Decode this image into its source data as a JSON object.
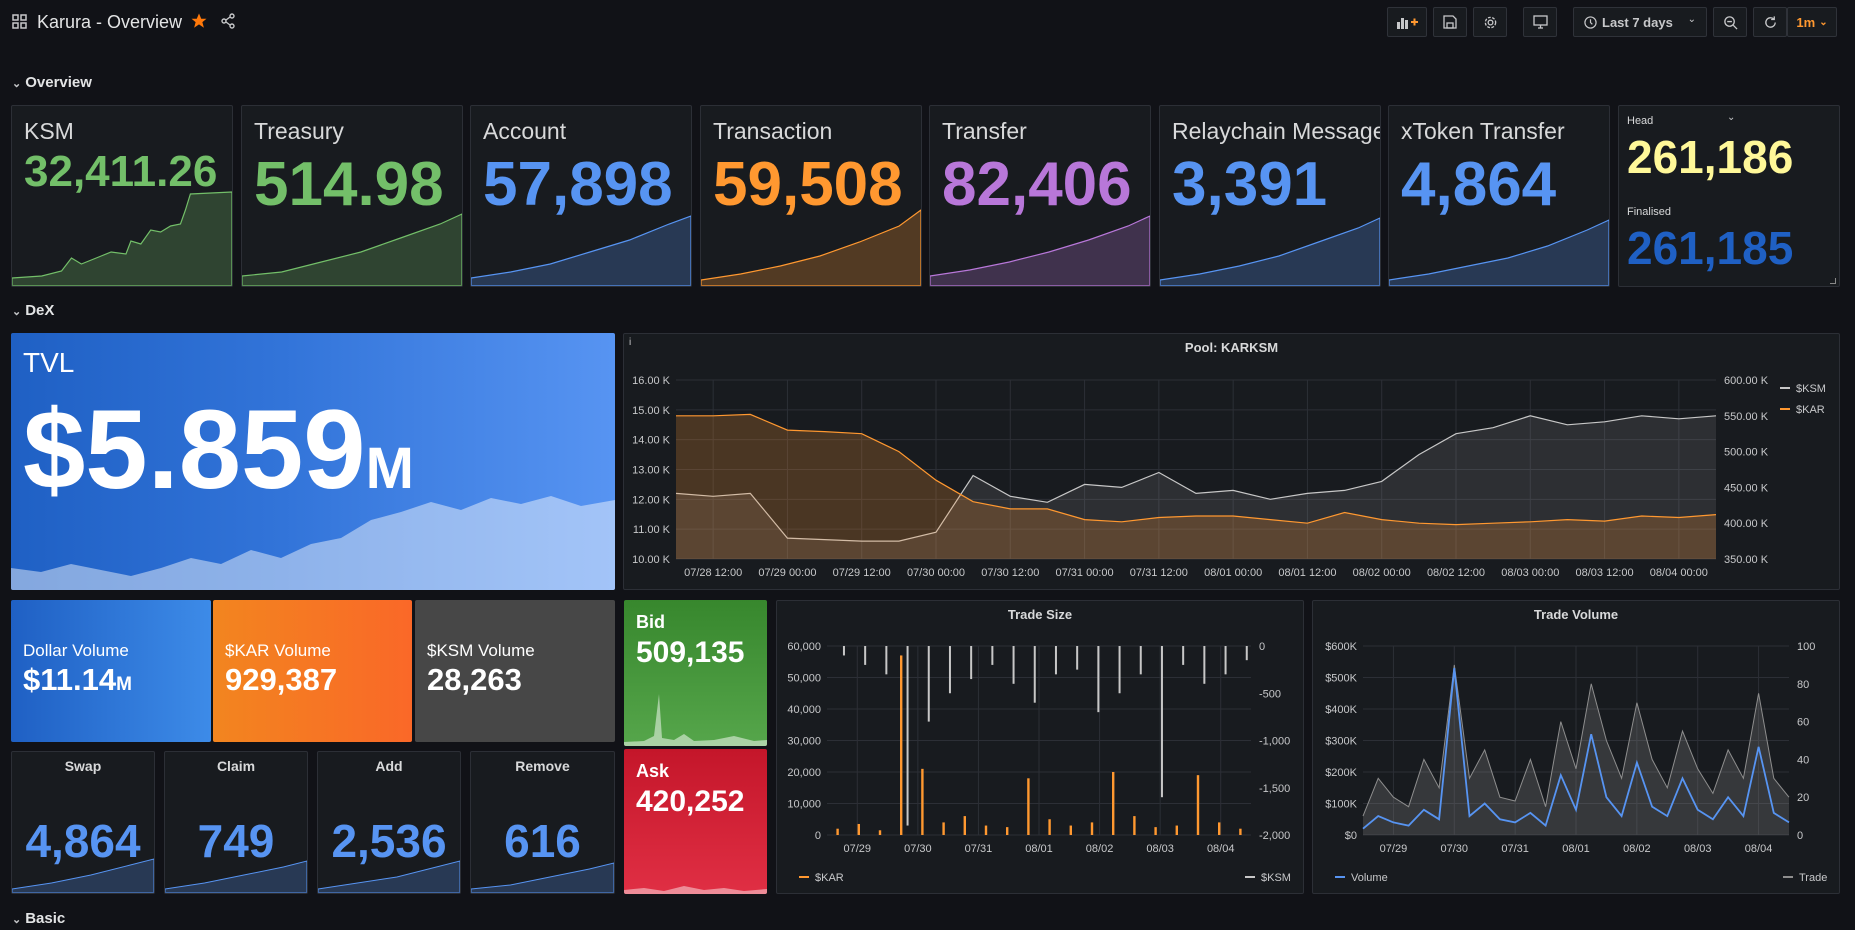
{
  "header": {
    "title": "Karura - Overview",
    "time_range": "Last 7 days",
    "refresh_interval": "1m"
  },
  "rows": {
    "overview": "Overview",
    "dex": "DeX",
    "basic": "Basic"
  },
  "stats": [
    {
      "title": "KSM",
      "value": "32,411.26",
      "color": "#73bf69"
    },
    {
      "title": "Treasury",
      "value": "514.98",
      "color": "#73bf69"
    },
    {
      "title": "Account",
      "value": "57,898",
      "color": "#5794f2"
    },
    {
      "title": "Transaction",
      "value": "59,508",
      "color": "#ff9830"
    },
    {
      "title": "Transfer",
      "value": "82,406",
      "color": "#b877d9"
    },
    {
      "title": "Relaychain Message",
      "value": "3,391",
      "color": "#5794f2"
    },
    {
      "title": "xToken Transfer",
      "value": "4,864",
      "color": "#5794f2"
    }
  ],
  "head": {
    "head_label": "Head",
    "head_value": "261,186",
    "finalised_label": "Finalised",
    "finalised_value": "261,185",
    "head_color": "#fff899",
    "finalised_color": "#1f60c4"
  },
  "tvl": {
    "title": "TVL",
    "value": "$5.859",
    "unit": "M"
  },
  "volumes": [
    {
      "title": "Dollar Volume",
      "value": "$11.14",
      "unit": "M"
    },
    {
      "title": "$KAR Volume",
      "value": "929,387",
      "unit": ""
    },
    {
      "title": "$KSM Volume",
      "value": "28,263",
      "unit": ""
    }
  ],
  "bid": {
    "title": "Bid",
    "value": "509,135"
  },
  "ask": {
    "title": "Ask",
    "value": "420,252"
  },
  "actions": [
    {
      "title": "Swap",
      "value": "4,864"
    },
    {
      "title": "Claim",
      "value": "749"
    },
    {
      "title": "Add",
      "value": "2,536"
    },
    {
      "title": "Remove",
      "value": "616"
    }
  ],
  "chart_data": [
    {
      "type": "line",
      "title": "Pool: KARKSM",
      "x_ticks": [
        "07/28 12:00",
        "07/29 00:00",
        "07/29 12:00",
        "07/30 00:00",
        "07/30 12:00",
        "07/31 00:00",
        "07/31 12:00",
        "08/01 00:00",
        "08/01 12:00",
        "08/02 00:00",
        "08/02 12:00",
        "08/03 00:00",
        "08/03 12:00",
        "08/04 00:00"
      ],
      "y_left_ticks": [
        "16.00 K",
        "15.00 K",
        "14.00 K",
        "13.00 K",
        "12.00 K",
        "11.00 K",
        "10.00 K"
      ],
      "y_right_ticks": [
        "600.00 K",
        "550.00 K",
        "500.00 K",
        "450.00 K",
        "400.00 K",
        "350.00 K"
      ],
      "ylim_left": [
        10000,
        16000
      ],
      "ylim_right": [
        350000,
        600000
      ],
      "series": [
        {
          "name": "$KSM",
          "axis": "left",
          "color": "#c7c7c7",
          "x": [
            0,
            0.5,
            1,
            1.5,
            2,
            2.5,
            3,
            3.5,
            4,
            4.5,
            5,
            5.5,
            6,
            6.5,
            7,
            7.5,
            8,
            8.5,
            9,
            9.5,
            10,
            10.5,
            11,
            11.5,
            12,
            12.5,
            13,
            13.5,
            14
          ],
          "values": [
            12200,
            12100,
            12200,
            10700,
            10650,
            10600,
            10600,
            10900,
            12800,
            12100,
            11900,
            12500,
            12400,
            12900,
            12200,
            12300,
            12000,
            12200,
            12300,
            12600,
            13500,
            14200,
            14400,
            14800,
            14500,
            14600,
            14800,
            14700,
            14800
          ]
        },
        {
          "name": "$KAR",
          "axis": "right",
          "color": "#ff9830",
          "x": [
            0,
            0.5,
            1,
            1.5,
            2,
            2.5,
            3,
            3.5,
            4,
            4.5,
            5,
            5.5,
            6,
            6.5,
            7,
            7.5,
            8,
            8.5,
            9,
            9.5,
            10,
            10.5,
            11,
            11.5,
            12,
            12.5,
            13,
            13.5,
            14
          ],
          "values": [
            550000,
            550000,
            552000,
            530000,
            528000,
            525000,
            500000,
            460000,
            430000,
            420000,
            420000,
            405000,
            402000,
            408000,
            410000,
            410000,
            405000,
            400000,
            415000,
            405000,
            400000,
            398000,
            400000,
            402000,
            405000,
            403000,
            410000,
            408000,
            412000
          ]
        }
      ]
    },
    {
      "type": "bar",
      "title": "Trade Size",
      "x_ticks": [
        "07/29",
        "07/30",
        "07/31",
        "08/01",
        "08/02",
        "08/03",
        "08/04"
      ],
      "y_left_ticks": [
        "60,000",
        "50,000",
        "40,000",
        "30,000",
        "20,000",
        "10,000",
        "0"
      ],
      "y_right_ticks": [
        "0",
        "-500",
        "-1,000",
        "-1,500",
        "-2,000"
      ],
      "ylim_left": [
        0,
        60000
      ],
      "ylim_right": [
        -2000,
        0
      ],
      "series": [
        {
          "name": "$KAR",
          "color": "#ff9830",
          "values": [
            2000,
            3500,
            1500,
            57000,
            21000,
            4000,
            6000,
            3000,
            2500,
            18000,
            5000,
            3000,
            4000,
            20000,
            6000,
            2500,
            3000,
            19000,
            4000,
            2000
          ]
        },
        {
          "name": "$KSM",
          "color": "#c7c7c7",
          "values": [
            -100,
            -200,
            -300,
            -1900,
            -800,
            -500,
            -350,
            -200,
            -400,
            -600,
            -300,
            -250,
            -700,
            -500,
            -300,
            -1600,
            -200,
            -400,
            -300,
            -150
          ]
        }
      ]
    },
    {
      "type": "line",
      "title": "Trade Volume",
      "x_ticks": [
        "07/29",
        "07/30",
        "07/31",
        "08/01",
        "08/02",
        "08/03",
        "08/04"
      ],
      "y_left_ticks": [
        "$600K",
        "$500K",
        "$400K",
        "$300K",
        "$200K",
        "$100K",
        "$0"
      ],
      "y_right_ticks": [
        "100",
        "80",
        "60",
        "40",
        "20",
        "0"
      ],
      "ylim_left": [
        0,
        600000
      ],
      "ylim_right": [
        0,
        100
      ],
      "series": [
        {
          "name": "Volume",
          "color": "#5794f2",
          "values": [
            20000,
            60000,
            40000,
            30000,
            80000,
            50000,
            530000,
            60000,
            100000,
            50000,
            40000,
            70000,
            30000,
            190000,
            80000,
            320000,
            120000,
            60000,
            230000,
            90000,
            60000,
            180000,
            80000,
            50000,
            120000,
            60000,
            280000,
            70000,
            40000
          ]
        },
        {
          "name": "Trade",
          "color": "#8e8e8e",
          "values": [
            10,
            30,
            20,
            15,
            40,
            25,
            90,
            30,
            45,
            20,
            18,
            40,
            15,
            60,
            35,
            80,
            50,
            30,
            70,
            40,
            25,
            55,
            35,
            22,
            45,
            30,
            75,
            30,
            20
          ]
        }
      ]
    }
  ]
}
